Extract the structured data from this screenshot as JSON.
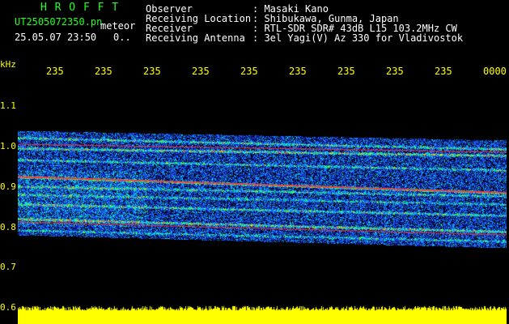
{
  "header": {
    "app_title": "H R O F F T",
    "filename": "UT2505072350.pn",
    "type_label": "meteor",
    "datetime": "25.05.07 23:50",
    "count": "0..",
    "fields": [
      {
        "label": "Observer",
        "value": ": Masaki Kano"
      },
      {
        "label": "Receiving Location",
        "value": ": Shibukawa, Gunma, Japan"
      },
      {
        "label": "Receiver",
        "value": ": RTL-SDR SDR# 43dB L15 103.2MHz CW"
      },
      {
        "label": "Receiving Antenna",
        "value": ": 3el Yagi(V) Az 330 for Vladivostok"
      }
    ]
  },
  "axis": {
    "unit": "kHz",
    "y_ticks": [
      "1.1",
      "1.0",
      "0.9",
      "0.8",
      "0.7",
      "0.6"
    ],
    "x_ticks": [
      "235",
      "235",
      "235",
      "235",
      "235",
      "235",
      "235",
      "235",
      "235",
      "0000"
    ]
  },
  "colors": {
    "background": "#000000",
    "header_label": "#ffffff",
    "title_green": "#22ff22",
    "axis_yellow": "#ffff00",
    "signal_red": "#ff3030",
    "noise_blue": "#0022cc"
  }
}
